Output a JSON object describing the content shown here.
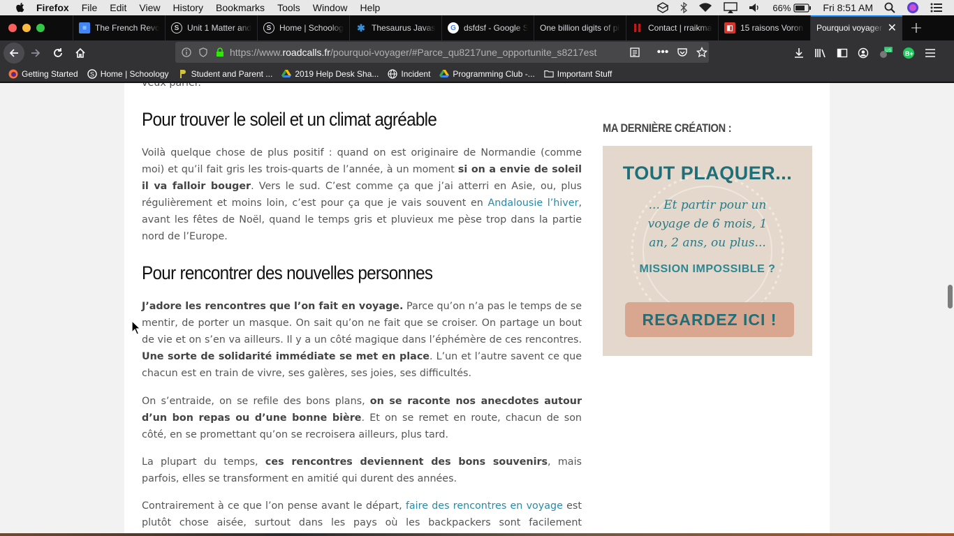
{
  "menubar": {
    "app_name": "Firefox",
    "items": [
      "File",
      "Edit",
      "View",
      "History",
      "Bookmarks",
      "Tools",
      "Window",
      "Help"
    ],
    "battery": "66%",
    "clock": "Fri 8:51 AM"
  },
  "tabs": [
    {
      "title": "The French Revo",
      "favicon": "docs-icon",
      "color": "#4285f4"
    },
    {
      "title": "Unit 1 Matter and",
      "favicon": "schoology-icon",
      "color": "#3a3a3a"
    },
    {
      "title": "Home | Schoolog",
      "favicon": "schoology-icon",
      "color": "#3a3a3a"
    },
    {
      "title": "Thesaurus Javas",
      "favicon": "puzzle-icon",
      "color": "#3a8fd9"
    },
    {
      "title": "dsfdsf - Google S",
      "favicon": "google-icon",
      "color": "#ffffff"
    },
    {
      "title": "One billion digits of pi",
      "favicon": "",
      "color": ""
    },
    {
      "title": "Contact | rraikma",
      "favicon": "bars-icon",
      "color": "#b81d1d"
    },
    {
      "title": "15 raisons Voron",
      "favicon": "square-icon",
      "color": "#d9342b"
    },
    {
      "title": "Pourquoi voyager",
      "favicon": "",
      "color": "",
      "active": true
    }
  ],
  "urlbar": {
    "prefix": "https://www.",
    "domain": "roadcalls.fr",
    "path": "/pourquoi-voyager/#Parce_qu8217une_opportunite_s8217est"
  },
  "bookmarks": [
    {
      "label": "Getting Started",
      "icon": "firefox-icon"
    },
    {
      "label": "Home | Schoology",
      "icon": "schoology-icon"
    },
    {
      "label": "Student and Parent ...",
      "icon": "parent-portal-icon"
    },
    {
      "label": "2019 Help Desk Sha...",
      "icon": "drive-icon"
    },
    {
      "label": "Incident",
      "icon": "globe-icon"
    },
    {
      "label": "Programming Club -...",
      "icon": "drive-icon"
    },
    {
      "label": "Important Stuff",
      "icon": "folder-icon"
    }
  ],
  "article": {
    "fragment": "veux parler.",
    "h_sun": "Pour trouver le soleil et un climat agréable",
    "p1a": "Voilà quelque chose de plus positif : quand on est originaire de Normandie (comme moi) et qu’il fait gris les trois-quarts de l’année, à un moment ",
    "p1b": "si on a envie de soleil il va falloir bouger",
    "p1c": ". Vers le sud. C’est comme ça que j’ai atterri en Asie, ou, plus régulière­ment et moins loin, c’est pour ça que je vais souvent en ",
    "p1link": "Andalousie l’hiver",
    "p1d": ", avant les fêtes de Noël, quand le temps gris et pluvieux me pèse trop dans la partie nord de l’Eu­rope.",
    "h_meet": "Pour rencontrer des nouvelles personnes",
    "p2a": "J’adore les rencontres que l’on fait en voyage.",
    "p2b": " Parce qu’on n’a pas le temps de se mentir, de porter un masque. On sait qu’on ne fait que se croiser. On partage un bout de vie et on s’en va ailleurs. Il y a un côté magique dans l’éphémère de ces rencontres. ",
    "p2c": "Une sorte de solidarité immédiate se met en place",
    "p2d": ". L’un et l’autre savent ce que chacun est en train de vivre, ses galères, ses joies, ses difficultés.",
    "p3a": "On s’entraide, on se refile des bons plans, ",
    "p3b": "on se raconte nos anecdotes autour d’un bon repas ou d’une bonne bière",
    "p3c": ". Et on se remet en route, chacun de son côté, en se promettant qu’on se recroisera ailleurs, plus tard.",
    "p4a": "La plupart du temps, ",
    "p4b": "ces rencontres deviennent des bons souvenirs",
    "p4c": ", mais parfois, elles se transforment en amitié qui durent des années.",
    "p5a": "Contrairement à ce que l’on pense avant le départ, ",
    "p5link": "faire des rencontres en voyage",
    "p5b": " est plutôt chose aisée, surtout dans les pays où les backpackers sont facilement identifiables"
  },
  "sidebar": {
    "title": "MA DERNIÈRE CRÉATION :",
    "promo_heading": "TOUT PLAQUER...",
    "promo_script_1": "... Et partir pour un",
    "promo_script_2": "voyage de 6 mois, 1",
    "promo_script_3": "an, 2 ans, ou plus...",
    "promo_mission": "MISSION IMPOSSIBLE ?",
    "promo_cta": "REGARDEZ ICI !"
  },
  "colors": {
    "accent": "#0a84ff",
    "link": "#2a8aa5",
    "promo_teal": "#1f6e78"
  }
}
